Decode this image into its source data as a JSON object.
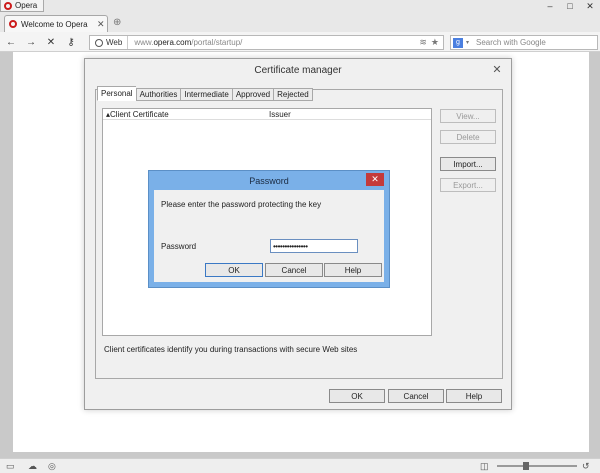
{
  "browser": {
    "menu_label": "Opera",
    "tab_title": "Welcome to Opera",
    "address": {
      "chip": "Web",
      "url_prefix": "www.",
      "url_host": "opera.com",
      "url_path": "/portal/startup/"
    },
    "search_placeholder": "Search with Google",
    "zoom_level": 0.35
  },
  "cert_manager": {
    "title": "Certificate manager",
    "tabs": [
      "Personal",
      "Authorities",
      "Intermediate",
      "Approved",
      "Rejected"
    ],
    "columns": [
      "Client Certificate",
      "Issuer"
    ],
    "side_buttons": {
      "view": "View...",
      "delete": "Delete",
      "import": "Import...",
      "export": "Export..."
    },
    "description": "Client certificates identify you during transactions with secure Web sites",
    "buttons": {
      "ok": "OK",
      "cancel": "Cancel",
      "help": "Help"
    }
  },
  "password_dialog": {
    "title": "Password",
    "message": "Please enter the password protecting the key",
    "label": "Password",
    "masked_value": "•••••••••••••••",
    "buttons": {
      "ok": "OK",
      "cancel": "Cancel",
      "help": "Help"
    }
  }
}
